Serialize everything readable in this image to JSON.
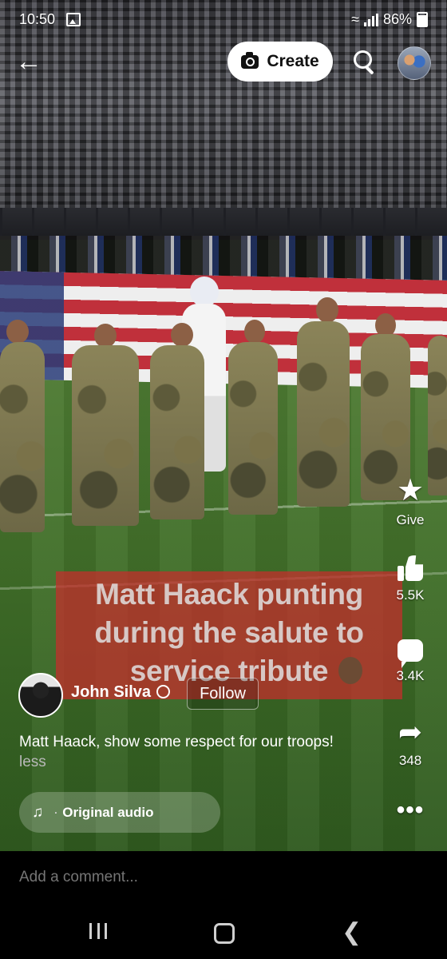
{
  "status_bar": {
    "time": "10:50",
    "battery": "86%"
  },
  "top_bar": {
    "create_label": "Create"
  },
  "caption": {
    "text": "Matt Haack punting during the salute to service tribute"
  },
  "actions": {
    "give_label": "Give",
    "likes": "5.5K",
    "comments": "3.4K",
    "shares": "348"
  },
  "author": {
    "name": "John Silva",
    "follow_label": "Follow"
  },
  "post": {
    "description": "Matt Haack, show some respect for our troops!",
    "less_label": "less"
  },
  "audio": {
    "label": "Original audio"
  },
  "comment": {
    "placeholder": "Add a comment..."
  },
  "icons": {
    "back": "back-arrow-icon",
    "camera": "camera-icon",
    "search": "search-icon",
    "star": "star-icon",
    "like": "thumbs-up-icon",
    "comment": "comment-icon",
    "share": "share-icon",
    "more": "more-icon",
    "music": "music-note-icon",
    "globe": "globe-icon"
  },
  "colors": {
    "caption_bg": "#c82d2d",
    "create_bg": "#ffffff",
    "page_bg": "#000000"
  }
}
